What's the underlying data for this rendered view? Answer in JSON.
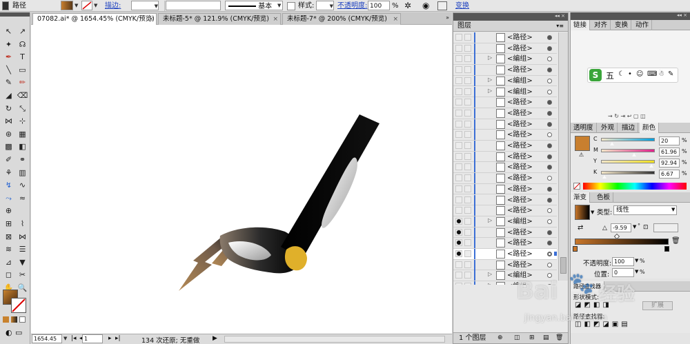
{
  "control_bar": {
    "object_type": "路径",
    "stroke_label": "描边:",
    "brush_label": "基本",
    "style_label": "样式:",
    "opacity_label": "不透明度:",
    "opacity_value": "100",
    "opacity_unit": "%",
    "transform_label": "变换"
  },
  "tabs": [
    {
      "label": "07082.ai* @ 1654.45% (CMYK/预览)"
    },
    {
      "label": "未标题-5* @ 121.9% (CMYK/预览)"
    },
    {
      "label": "未标题-7* @ 200% (CMYK/预览)"
    }
  ],
  "status": {
    "zoom": "1654.45",
    "artboard": "1",
    "message": "134 次还原; 无重做"
  },
  "layers_panel": {
    "title": "图层",
    "footer": "1 个图层",
    "rows": [
      {
        "name": "<路径>",
        "expand": "",
        "filled": true
      },
      {
        "name": "<路径>",
        "expand": "",
        "filled": true
      },
      {
        "name": "<编组>",
        "expand": "▷",
        "filled": false
      },
      {
        "name": "<路径>",
        "expand": "",
        "filled": true
      },
      {
        "name": "<编组>",
        "expand": "▷",
        "filled": false
      },
      {
        "name": "<编组>",
        "expand": "▷",
        "filled": false
      },
      {
        "name": "<路径>",
        "expand": "",
        "filled": true
      },
      {
        "name": "<路径>",
        "expand": "",
        "filled": true
      },
      {
        "name": "<路径>",
        "expand": "",
        "filled": true
      },
      {
        "name": "<路径>",
        "expand": "",
        "filled": false
      },
      {
        "name": "<路径>",
        "expand": "",
        "filled": true
      },
      {
        "name": "<路径>",
        "expand": "",
        "filled": true
      },
      {
        "name": "<路径>",
        "expand": "",
        "filled": true
      },
      {
        "name": "<路径>",
        "expand": "",
        "filled": false
      },
      {
        "name": "<路径>",
        "expand": "",
        "filled": true
      },
      {
        "name": "<路径>",
        "expand": "",
        "filled": true
      },
      {
        "name": "<路径>",
        "expand": "",
        "filled": false
      },
      {
        "name": "<编组>",
        "expand": "▷",
        "filled": false
      },
      {
        "name": "<路径>",
        "expand": "",
        "filled": true
      },
      {
        "name": "<路径>",
        "expand": "",
        "filled": true
      },
      {
        "name": "<路径>",
        "expand": "",
        "filled": false
      },
      {
        "name": "<路径>",
        "expand": "",
        "filled": false
      },
      {
        "name": "<编组>",
        "expand": "▷",
        "filled": false
      },
      {
        "name": "<编组>",
        "expand": "▷",
        "filled": false
      }
    ]
  },
  "ime_panel": {
    "tabs": [
      "链接",
      "对齐",
      "变换",
      "动作"
    ]
  },
  "color_panel": {
    "tabs": [
      "透明度",
      "外观",
      "描边",
      "颜色"
    ],
    "channels": [
      {
        "label": "C",
        "value": "20",
        "level": 0.2,
        "color": "#00a0e0"
      },
      {
        "label": "M",
        "value": "61.96",
        "level": 0.62,
        "color": "#e0208a"
      },
      {
        "label": "Y",
        "value": "92.94",
        "level": 0.93,
        "color": "#f0e020"
      },
      {
        "label": "K",
        "value": "6.67",
        "level": 0.07,
        "color": "#333333"
      }
    ],
    "unit": "%",
    "fill_color": "#c87f2f"
  },
  "gradient_panel": {
    "tabs": [
      "渐变",
      "色板"
    ],
    "type_label": "类型:",
    "type_value": "线性",
    "angle": "-9.59",
    "angle_unit": "°",
    "opacity_label": "不透明度:",
    "opacity_value": "100",
    "location_label": "位置:",
    "location_value": "0",
    "unit": "%",
    "stop_start_color": "#c8762a",
    "stop_end_color": "#000000"
  },
  "bottom_panel": {
    "tabs": [
      "路径查找器"
    ],
    "shape_mode": "形状模式:",
    "expand_button": "扩展",
    "pathfinder_label": "路径查找器:"
  },
  "watermark": {
    "brand": "Bai",
    "brand_suffix": "经验",
    "url": "jingyan.baidu.com"
  }
}
